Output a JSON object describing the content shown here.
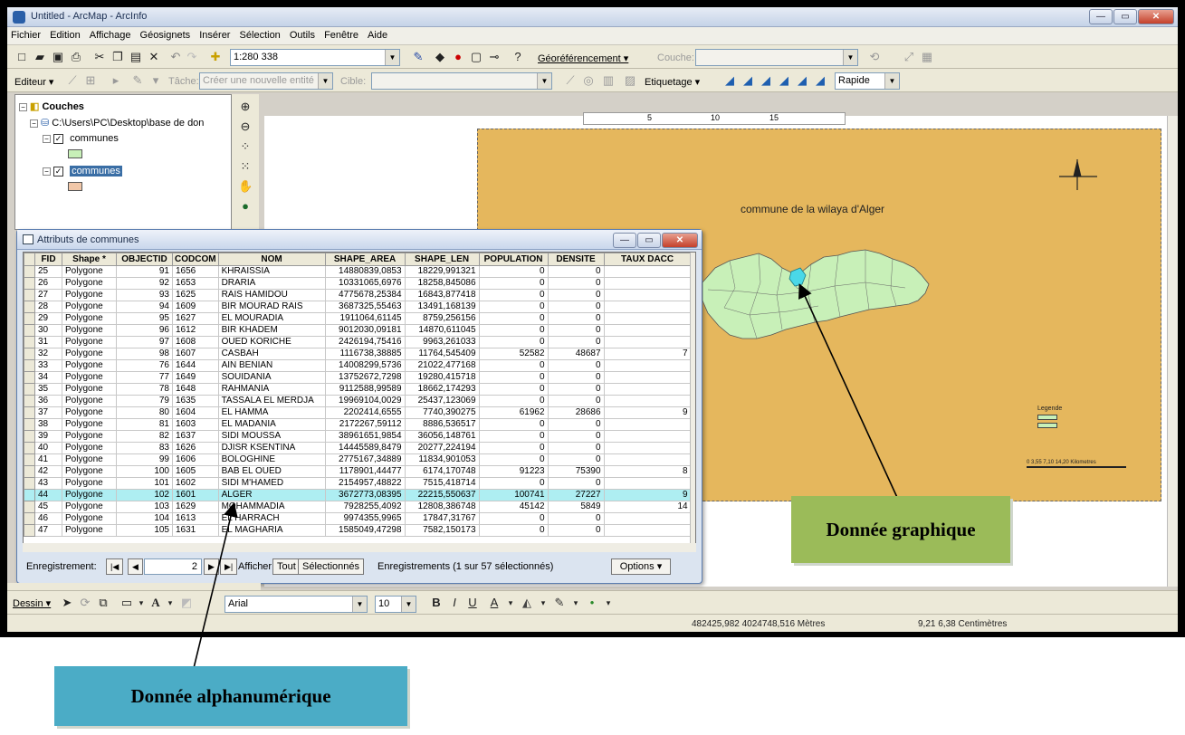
{
  "window": {
    "title": "Untitled - ArcMap - ArcInfo",
    "buttons": [
      "—",
      "▭",
      "✕"
    ]
  },
  "menu": [
    "Fichier",
    "Edition",
    "Affichage",
    "Géosignets",
    "Insérer",
    "Sélection",
    "Outils",
    "Fenêtre",
    "Aide"
  ],
  "toolbar1": {
    "scale": "1:280 338",
    "georef_label": "Géoréférencement ▾",
    "couche_label": "Couche:"
  },
  "toolbar2": {
    "editor_label": "Editeur ▾",
    "tache_label": "Tâche:",
    "tache_value": "Créer une nouvelle entité",
    "cible_label": "Cible:",
    "etiquetage_label": "Etiquetage ▾",
    "rapide_value": "Rapide"
  },
  "toc": {
    "root": "Couches",
    "path": "C:\\Users\\PC\\Desktop\\base de don",
    "layer1": "communes",
    "layer2": "communes"
  },
  "ruler": {
    "marks": [
      "5",
      "10",
      "15"
    ]
  },
  "map": {
    "title": "commune de la wilaya d'Alger",
    "legend_title": "Legende",
    "legend_items": [
      "communes",
      "communes"
    ],
    "scale_text": "0   3,55  7,10        14,20 Kilometres"
  },
  "attr": {
    "title": "Attributs de communes",
    "columns": [
      "",
      "FID",
      "Shape *",
      "OBJECTID",
      "CODCOM",
      "NOM",
      "SHAPE_AREA",
      "SHAPE_LEN",
      "POPULATION",
      "DENSITE",
      "TAUX DACC"
    ],
    "rows": [
      [
        "25",
        "Polygone",
        "91",
        "1656",
        "KHRAISSIA",
        "14880839,0853",
        "18229,991321",
        "0",
        "0",
        ""
      ],
      [
        "26",
        "Polygone",
        "92",
        "1653",
        "DRARIA",
        "10331065,6976",
        "18258,845086",
        "0",
        "0",
        ""
      ],
      [
        "27",
        "Polygone",
        "93",
        "1625",
        "RAIS HAMIDOU",
        "4775678,25384",
        "16843,877418",
        "0",
        "0",
        ""
      ],
      [
        "28",
        "Polygone",
        "94",
        "1609",
        "BIR MOURAD RAIS",
        "3687325,55463",
        "13491,168139",
        "0",
        "0",
        ""
      ],
      [
        "29",
        "Polygone",
        "95",
        "1627",
        "EL MOURADIA",
        "1911064,61145",
        "8759,256156",
        "0",
        "0",
        ""
      ],
      [
        "30",
        "Polygone",
        "96",
        "1612",
        "BIR KHADEM",
        "9012030,09181",
        "14870,611045",
        "0",
        "0",
        ""
      ],
      [
        "31",
        "Polygone",
        "97",
        "1608",
        "OUED KORICHE",
        "2426194,75416",
        "9963,261033",
        "0",
        "0",
        ""
      ],
      [
        "32",
        "Polygone",
        "98",
        "1607",
        "CASBAH",
        "1116738,38885",
        "11764,545409",
        "52582",
        "48687",
        "7"
      ],
      [
        "33",
        "Polygone",
        "76",
        "1644",
        "AIN BENIAN",
        "14008299,5736",
        "21022,477168",
        "0",
        "0",
        ""
      ],
      [
        "34",
        "Polygone",
        "77",
        "1649",
        "SOUIDANIA",
        "13752672,7298",
        "19280,415718",
        "0",
        "0",
        ""
      ],
      [
        "35",
        "Polygone",
        "78",
        "1648",
        "RAHMANIA",
        "9112588,99589",
        "18662,174293",
        "0",
        "0",
        ""
      ],
      [
        "36",
        "Polygone",
        "79",
        "1635",
        "TASSALA EL MERDJA",
        "19969104,0029",
        "25437,123069",
        "0",
        "0",
        ""
      ],
      [
        "37",
        "Polygone",
        "80",
        "1604",
        "EL HAMMA",
        "2202414,6555",
        "7740,390275",
        "61962",
        "28686",
        "9"
      ],
      [
        "38",
        "Polygone",
        "81",
        "1603",
        "EL MADANIA",
        "2172267,59112",
        "8886,536517",
        "0",
        "0",
        ""
      ],
      [
        "39",
        "Polygone",
        "82",
        "1637",
        "SIDI MOUSSA",
        "38961651,9854",
        "36056,148761",
        "0",
        "0",
        ""
      ],
      [
        "40",
        "Polygone",
        "83",
        "1626",
        "DJISR KSENTINA",
        "14445589,8479",
        "20277,224194",
        "0",
        "0",
        ""
      ],
      [
        "41",
        "Polygone",
        "99",
        "1606",
        "BOLOGHINE",
        "2775167,34889",
        "11834,901053",
        "0",
        "0",
        ""
      ],
      [
        "42",
        "Polygone",
        "100",
        "1605",
        "BAB EL OUED",
        "1178901,44477",
        "6174,170748",
        "91223",
        "75390",
        "8"
      ],
      [
        "43",
        "Polygone",
        "101",
        "1602",
        "SIDI M'HAMED",
        "2154957,48822",
        "7515,418714",
        "0",
        "0",
        ""
      ],
      [
        "44",
        "Polygone",
        "102",
        "1601",
        "ALGER",
        "3672773,08395",
        "22215,550637",
        "100741",
        "27227",
        "9"
      ],
      [
        "45",
        "Polygone",
        "103",
        "1629",
        "MOHAMMADIA",
        "7928255,4092",
        "12808,386748",
        "45142",
        "5849",
        "14"
      ],
      [
        "46",
        "Polygone",
        "104",
        "1613",
        "EL HARRACH",
        "9974355,9965",
        "17847,31767",
        "0",
        "0",
        ""
      ],
      [
        "47",
        "Polygone",
        "105",
        "1631",
        "EL MAGHARIA",
        "1585049,47298",
        "7582,150173",
        "0",
        "0",
        ""
      ]
    ],
    "highlighted_fid": "44",
    "footer": {
      "record_label": "Enregistrement:",
      "record_value": "2",
      "show_label": "Afficher:",
      "tout": "Tout",
      "selection": "Sélectionnés",
      "records_info": "Enregistrements (1 sur 57 sélectionnés)",
      "options": "Options ▾"
    }
  },
  "drawbar": {
    "dessin_label": "Dessin ▾",
    "font": "Arial",
    "size": "10"
  },
  "status": {
    "coords": "482425,982  4024748,516 Mètres",
    "page_coords": "9,21  6,38 Centimètres"
  },
  "callouts": {
    "graph": "Donnée graphique",
    "alpha": "Donnée alphanumérique"
  },
  "colors": {
    "map_bg": "#e5b75d",
    "polygons": "#c8f0b8",
    "selected": "#4ad8e8",
    "callout_graph": "#9bbb59",
    "callout_alpha": "#4bacc6"
  }
}
